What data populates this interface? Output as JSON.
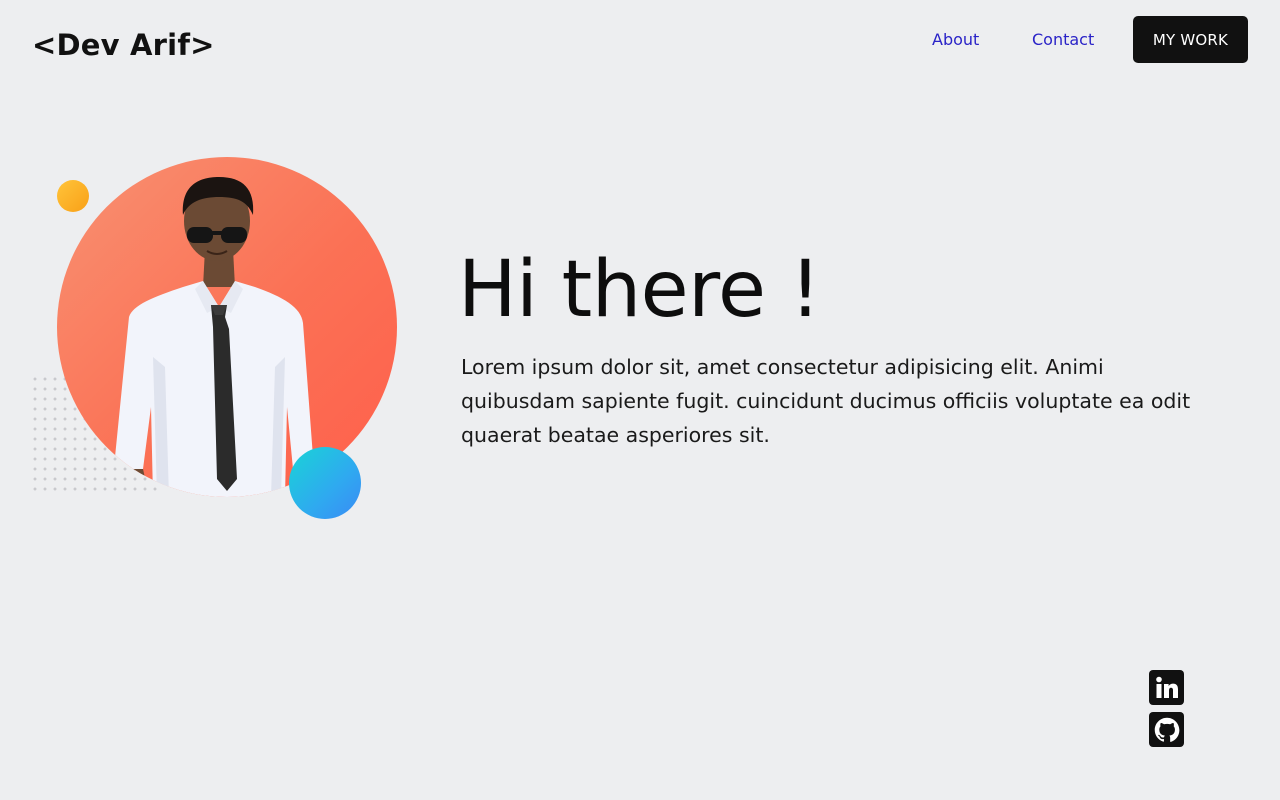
{
  "header": {
    "logo": "<Dev Arif>",
    "nav": {
      "about": "About",
      "contact": "Contact"
    },
    "cta_label": "MY WORK"
  },
  "hero": {
    "title": "Hi there !",
    "description": "Lorem ipsum dolor sit, amet consectetur adipisicing elit. Animi quibusdam sapiente fugit. cuincidunt ducimus officiis voluptate ea odit quaerat beatae asperiores sit."
  },
  "socials": [
    {
      "icon": "linkedin-icon"
    },
    {
      "icon": "github-icon"
    }
  ],
  "colors": {
    "background": "#edeef0",
    "nav_link": "#2a23c7",
    "cta_bg": "#111111",
    "photo_circle": "#fb7155",
    "accent_orange": "#fbb22a",
    "accent_blue": "#2fa9f0"
  }
}
